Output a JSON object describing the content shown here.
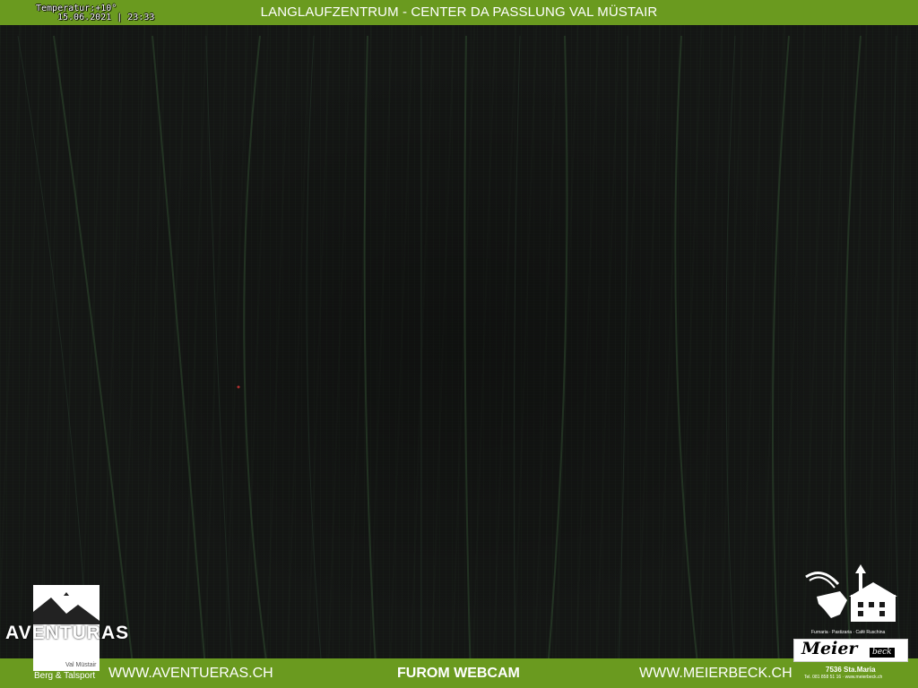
{
  "header": {
    "title": "LANGLAUFZENTRUM - CENTER DA PASSLUNG VAL MÜSTAIR"
  },
  "overlay": {
    "temperature": "Temperatur:+10°",
    "datetime": "15.06.2021 | 23:33"
  },
  "footer": {
    "left_link": "WWW.AVENTUERAS.CH",
    "center_label": "FUROM WEBCAM",
    "right_link": "WWW.MEIERBECK.CH"
  },
  "logo_aventuras": {
    "name": "AVENTURAS",
    "region": "Val Müstair",
    "tagline": "Berg & Talsport"
  },
  "logo_meierbeck": {
    "name": "Meier",
    "name_suffix": "beck",
    "tagline": "Furnaria · Pastizaria · Café Ruschina",
    "place": "7536 Sta.Maria",
    "contact": "Tel. 081 858 51 16 · www.meierbeck.ch"
  },
  "colors": {
    "bar_green": "#6a9a1f",
    "night_sky": "#141614"
  }
}
